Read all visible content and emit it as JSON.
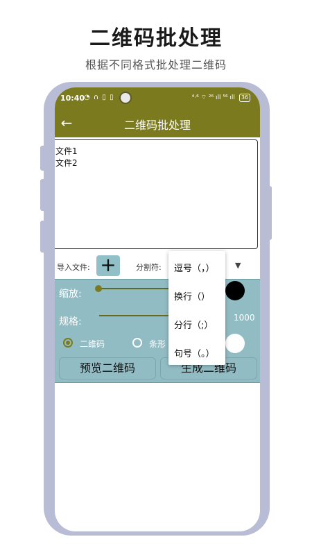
{
  "header": {
    "title": "二维码批处理",
    "subtitle": "根据不同格式批处理二维码"
  },
  "status_bar": {
    "time": "10:40",
    "left_icons": "◔ ∩ ▯ ▯",
    "right_icons": "⁴·⁶ ⌔ ²⁶ ıll ⁵⁶ ıll",
    "battery": "36"
  },
  "app_bar": {
    "back_icon": "←",
    "title": "二维码批处理"
  },
  "text_area": {
    "lines": [
      "文件1",
      "文件2"
    ]
  },
  "import": {
    "label": "导入文件:",
    "add_icon": "+",
    "separator_label": "分割符:",
    "dropdown_icon": "▼"
  },
  "settings": {
    "zoom_label": "缩放:",
    "spec_label": "规格:",
    "spec_value": "1000",
    "radio_qr_label": "二维码",
    "radio_barcode_label": "条形",
    "preview_button": "预览二维码",
    "generate_button": "生成二维码",
    "colors": {
      "foreground": "#000000",
      "background": "#ffffff"
    }
  },
  "separator_menu": {
    "items": [
      "逗号（，）",
      "换行（）",
      "分行（;）",
      "句号（。）"
    ]
  },
  "theme": {
    "primary": "#7b7a1f",
    "panel": "#92bcc4",
    "phone_frame": "#b8bcd4"
  }
}
